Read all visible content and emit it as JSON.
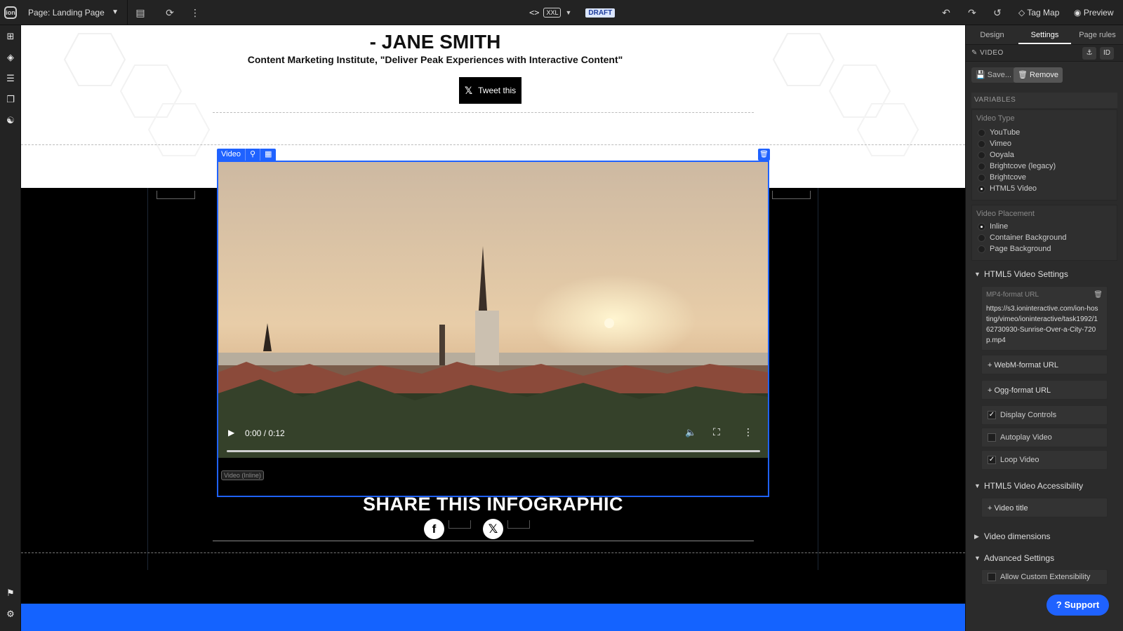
{
  "topbar": {
    "page_prefix": "Page:",
    "page_name": "Landing Page",
    "breakpoint": "XXL",
    "status": "DRAFT",
    "tag_map": "Tag Map",
    "preview": "Preview"
  },
  "canvas": {
    "author": "- JANE SMITH",
    "source": "Content Marketing Institute, \"Deliver Peak Experiences with Interactive Content\"",
    "tweet": "Tweet this",
    "video_tag": "Video",
    "video_time": "0:00 / 0:12",
    "video_label": "Video (Inline)",
    "share_title": "SHARE THIS INFOGRAPHIC"
  },
  "panel": {
    "tabs": [
      "Design",
      "Settings",
      "Page rules"
    ],
    "active_tab": "Settings",
    "selected": "VIDEO",
    "id_label": "ID",
    "save": "Save...",
    "remove": "Remove",
    "variables": "VARIABLES",
    "video_type_title": "Video Type",
    "video_types": [
      "YouTube",
      "Vimeo",
      "Ooyala",
      "Brightcove (legacy)",
      "Brightcove",
      "HTML5 Video"
    ],
    "video_type_selected": "HTML5 Video",
    "placement_title": "Video Placement",
    "placements": [
      "Inline",
      "Container Background",
      "Page Background"
    ],
    "placement_selected": "Inline",
    "html5_settings": "HTML5 Video Settings",
    "mp4_label": "MP4-format URL",
    "mp4_url": "https://s3.ioninteractive.com/ion-hosting/vimeo/ioninteractive/task1992/162730930-Sunrise-Over-a-City-720p.mp4",
    "webm": "+ WebM-format URL",
    "ogg": "+ Ogg-format URL",
    "display_controls": "Display Controls",
    "autoplay": "Autoplay Video",
    "loop": "Loop Video",
    "accessibility": "HTML5 Video Accessibility",
    "video_title": "+ Video title",
    "dimensions": "Video dimensions",
    "advanced": "Advanced Settings",
    "custom_ext": "Allow Custom Extensibility"
  },
  "support": "Support",
  "colors": {
    "accent": "#1f62ff",
    "panel": "#2b2b2b",
    "canvas_black": "#000000"
  }
}
